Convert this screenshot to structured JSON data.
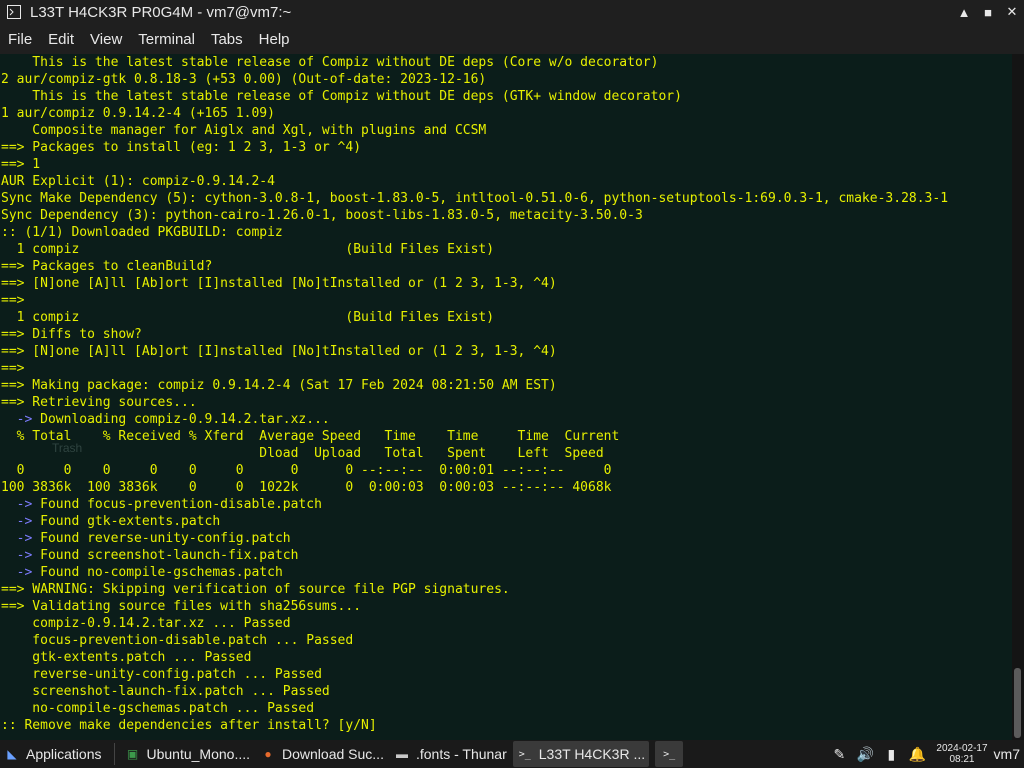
{
  "window": {
    "title": "L33T H4CK3R PR0G4M - vm7@vm7:~",
    "icon": "terminal-icon",
    "controls": {
      "minimize": "▲",
      "maximize": "■",
      "close": "✕"
    }
  },
  "menu": [
    "File",
    "Edit",
    "View",
    "Terminal",
    "Tabs",
    "Help"
  ],
  "terminal": {
    "colors": {
      "background": "#0b1d1a",
      "text": "#e6f000",
      "arrow": "#7d7dff"
    },
    "lines": [
      "    This is the latest stable release of Compiz without DE deps (Core w/o decorator)",
      "2 aur/compiz-gtk 0.8.18-3 (+53 0.00) (Out-of-date: 2023-12-16)",
      "    This is the latest stable release of Compiz without DE deps (GTK+ window decorator)",
      "1 aur/compiz 0.9.14.2-4 (+165 1.09)",
      "    Composite manager for Aiglx and Xgl, with plugins and CCSM",
      "==> Packages to install (eg: 1 2 3, 1-3 or ^4)",
      "==> 1",
      "AUR Explicit (1): compiz-0.9.14.2-4",
      "Sync Make Dependency (5): cython-3.0.8-1, boost-1.83.0-5, intltool-0.51.0-6, python-setuptools-1:69.0.3-1, cmake-3.28.3-1",
      "Sync Dependency (3): python-cairo-1.26.0-1, boost-libs-1.83.0-5, metacity-3.50.0-3",
      ":: (1/1) Downloaded PKGBUILD: compiz",
      "  1 compiz                                  (Build Files Exist)",
      "==> Packages to cleanBuild?",
      "==> [N]one [A]ll [Ab]ort [I]nstalled [No]tInstalled or (1 2 3, 1-3, ^4)",
      "==>",
      "  1 compiz                                  (Build Files Exist)",
      "==> Diffs to show?",
      "==> [N]one [A]ll [Ab]ort [I]nstalled [No]tInstalled or (1 2 3, 1-3, ^4)",
      "==>",
      "==> Making package: compiz 0.9.14.2-4 (Sat 17 Feb 2024 08:21:50 AM EST)",
      "==> Retrieving sources...",
      "  -> Downloading compiz-0.9.14.2.tar.xz...",
      "  % Total    % Received % Xferd  Average Speed   Time    Time     Time  Current",
      "                                 Dload  Upload   Total   Spent    Left  Speed",
      "  0     0    0     0    0     0      0      0 --:--:--  0:00:01 --:--:--     0",
      "100 3836k  100 3836k    0     0  1022k      0  0:00:03  0:00:03 --:--:-- 4068k",
      "  -> Found focus-prevention-disable.patch",
      "  -> Found gtk-extents.patch",
      "  -> Found reverse-unity-config.patch",
      "  -> Found screenshot-launch-fix.patch",
      "  -> Found no-compile-gschemas.patch",
      "==> WARNING: Skipping verification of source file PGP signatures.",
      "==> Validating source files with sha256sums...",
      "    compiz-0.9.14.2.tar.xz ... Passed",
      "    focus-prevention-disable.patch ... Passed",
      "    gtk-extents.patch ... Passed",
      "    reverse-unity-config.patch ... Passed",
      "    screenshot-launch-fix.patch ... Passed",
      "    no-compile-gschemas.patch ... Passed",
      ":: Remove make dependencies after install? [y/N]"
    ],
    "ghost_text": "Trash"
  },
  "taskbar": {
    "tasks": [
      {
        "label": "Applications",
        "icon": "applications-menu-icon",
        "glyph": "◣"
      },
      {
        "label": "Ubuntu_Mono....",
        "icon": "font-file-icon",
        "glyph": "▣"
      },
      {
        "label": "Download Suc...",
        "icon": "firefox-icon",
        "glyph": "●"
      },
      {
        "label": ".fonts - Thunar",
        "icon": "folder-icon",
        "glyph": "▬"
      },
      {
        "label": "L33T H4CK3R ...",
        "icon": "terminal-icon",
        "glyph": ">_"
      }
    ],
    "tray": [
      {
        "icon": "pen-icon",
        "glyph": "✎"
      },
      {
        "icon": "volume-icon",
        "glyph": "🔊"
      },
      {
        "icon": "battery-icon",
        "glyph": "▮"
      },
      {
        "icon": "notification-bell-icon",
        "glyph": "🔔"
      }
    ],
    "date": "2024-02-17",
    "time": "08:21",
    "user": "vm7"
  }
}
